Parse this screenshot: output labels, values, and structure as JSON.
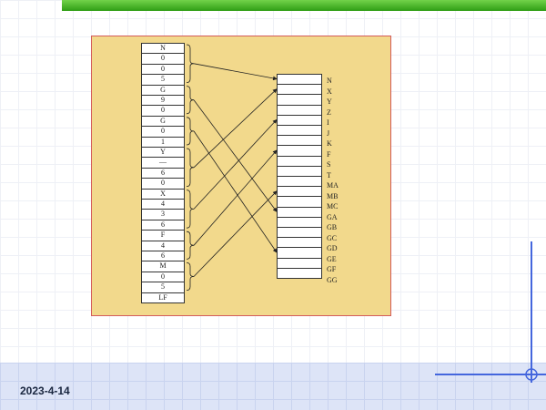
{
  "left_column": [
    "N",
    "0",
    "0",
    "5",
    "G",
    "9",
    "0",
    "G",
    "0",
    "1",
    "Y",
    "—",
    "6",
    "0",
    "X",
    "4",
    "3",
    "6",
    "F",
    "4",
    "6",
    "M",
    "0",
    "5",
    "LF"
  ],
  "right_labels": [
    "N",
    "X",
    "Y",
    "Z",
    "I",
    "J",
    "K",
    "F",
    "S",
    "T",
    "MA",
    "MB",
    "MC",
    "GA",
    "GB",
    "GC",
    "GD",
    "GE",
    "GF",
    "GG"
  ],
  "right_cell_count": 20,
  "groups": [
    {
      "from": 0,
      "to": 3
    },
    {
      "from": 4,
      "to": 6
    },
    {
      "from": 7,
      "to": 9
    },
    {
      "from": 10,
      "to": 13
    },
    {
      "from": 14,
      "to": 17
    },
    {
      "from": 18,
      "to": 20
    },
    {
      "from": 21,
      "to": 23
    }
  ],
  "arrows": [
    {
      "from_group": 0,
      "to_cell": 0
    },
    {
      "from_group": 1,
      "to_cell": 13
    },
    {
      "from_group": 2,
      "to_cell": 17
    },
    {
      "from_group": 3,
      "to_cell": 1
    },
    {
      "from_group": 4,
      "to_cell": 4
    },
    {
      "from_group": 5,
      "to_cell": 7
    },
    {
      "from_group": 6,
      "to_cell": 11
    }
  ],
  "footer": {
    "date": "2023-4-14"
  },
  "colors": {
    "panel": "#f2d98c",
    "panel_border": "#d35b5b",
    "top_bar": "#3aa81c",
    "accent_line": "#4466dd"
  }
}
